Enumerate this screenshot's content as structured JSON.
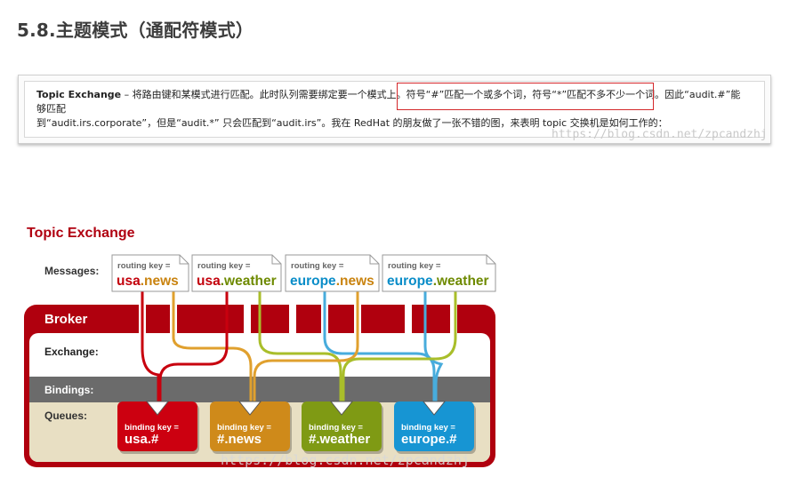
{
  "heading": "5.8.主题模式（通配符模式）",
  "quote": {
    "term": "Topic Exchange",
    "text_a": " – 将路由键和某模式进行匹配。此时队列需要绑定要一个模式上。符号“#”匹配一个或多个词，符号“*”匹配不多不少一个词。因此“audit.#”能够匹配",
    "text_b": "到“audit.irs.corporate”，但是“audit.*” 只会匹配到“audit.irs”。我在 RedHat 的朋友做了一张不错的图，来表明 topic 交换机是如何工作的："
  },
  "watermark": "https://blog.csdn.net/zpcandzhj",
  "diagram": {
    "title": "Topic Exchange",
    "messages_label": "Messages:",
    "broker_label": "Broker",
    "exchange_label": "Exchange:",
    "bindings_label": "Bindings:",
    "queues_label": "Queues:",
    "routing_key_caption": "routing key =",
    "binding_key_caption": "binding key =",
    "messages": [
      {
        "part1": "usa",
        "part2": ".news",
        "c1": "#c3000b",
        "c2": "#c9830f"
      },
      {
        "part1": "usa",
        "part2": ".weather",
        "c1": "#c3000b",
        "c2": "#6e8a00"
      },
      {
        "part1": "europe",
        "part2": ".news",
        "c1": "#0a8dc8",
        "c2": "#c9830f"
      },
      {
        "part1": "europe",
        "part2": ".weather",
        "c1": "#0a8dc8",
        "c2": "#6e8a00"
      }
    ],
    "queues": [
      {
        "key": "usa.#",
        "color": "#cc0010"
      },
      {
        "key": "#.news",
        "color": "#cf8a1a"
      },
      {
        "key": "#.weather",
        "color": "#7f9a14"
      },
      {
        "key": "europe.#",
        "color": "#1795d3"
      }
    ],
    "colors": {
      "broker": "#b0000e",
      "bindings_band": "#6b6b6b",
      "queues_band": "#e8dfc3",
      "line_red": "#c8000e",
      "line_orange": "#e0a02e",
      "line_green": "#a9be2a",
      "line_blue": "#48acdc"
    }
  }
}
